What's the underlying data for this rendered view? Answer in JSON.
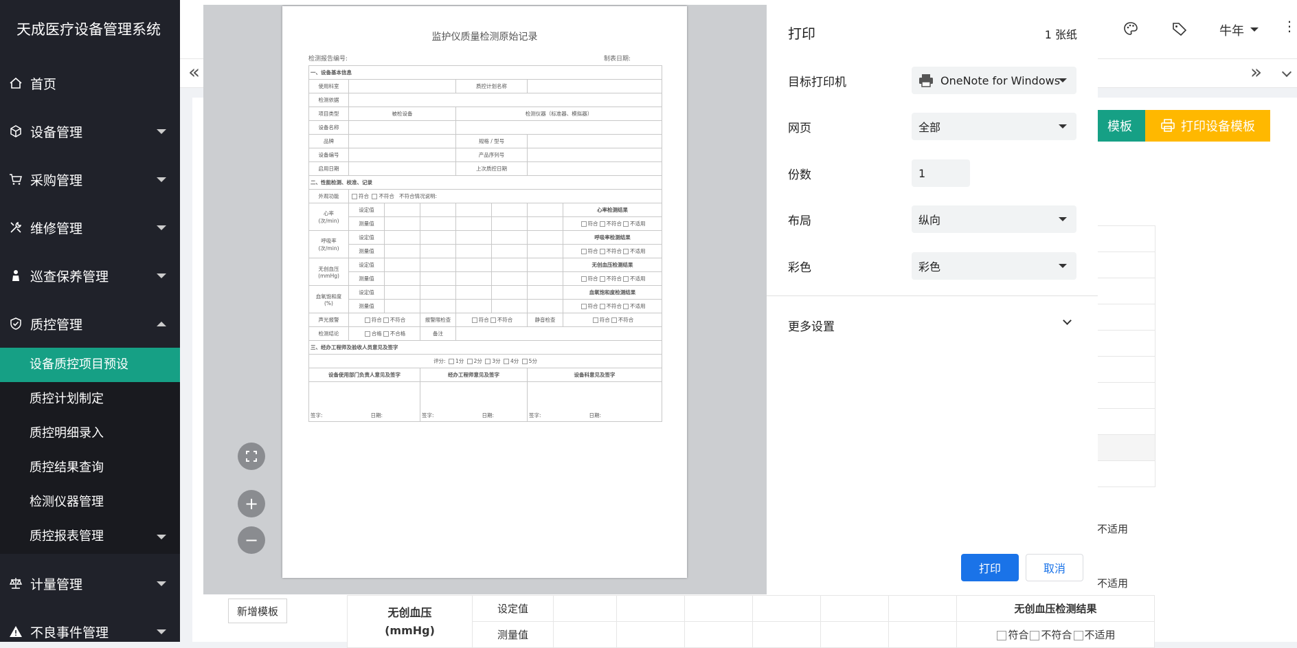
{
  "sidebar": {
    "brand": "天成医疗设备管理系统",
    "items": [
      {
        "label": "首页"
      },
      {
        "label": "设备管理"
      },
      {
        "label": "采购管理"
      },
      {
        "label": "维修管理"
      },
      {
        "label": "巡查保养管理"
      },
      {
        "label": "质控管理"
      }
    ],
    "submenu": [
      {
        "label": "设备质控项目预设"
      },
      {
        "label": "质控计划制定"
      },
      {
        "label": "质控明细录入"
      },
      {
        "label": "质控结果查询"
      },
      {
        "label": "检测仪器管理"
      },
      {
        "label": "质控报表管理"
      }
    ],
    "bottom_items": [
      {
        "label": "计量管理"
      },
      {
        "label": "不良事件管理"
      }
    ]
  },
  "header": {
    "user": "牛年",
    "collapse_glyph": "«",
    "expand_glyph": "»"
  },
  "background": {
    "template_button": "模板",
    "print_template_button": "打印设备模板",
    "add_template_button": "新增模板",
    "not_applicable_1": "不适用",
    "not_applicable_2": "不适用",
    "nibp_label": "无创血压",
    "nibp_unit": "(mmHg)",
    "set_value": "设定值",
    "measured_value": "测量值",
    "nibp_result": "无创血压检测结果",
    "conform": "符合",
    "not_conform": "不符合",
    "not_applicable": "不适用"
  },
  "document": {
    "title": "监护仪质量检测原始记录",
    "report_no": "检测报告编号:",
    "date": "制表日期:",
    "sec1": "一、设备基本信息",
    "use_dept": "使用科室",
    "plan_name": "质控计划名称",
    "basis": "检测依据",
    "item_type": "项目类型",
    "checked_device": "被检设备",
    "instrument": "检测仪器（标准器、模拟器）",
    "device_name": "设备名称",
    "brand": "品牌",
    "model": "规格 / 型号",
    "device_no": "设备编号",
    "serial": "产品序列号",
    "start_date": "启用日期",
    "last_qc": "上次质控日期",
    "sec2": "二、性能检测、校准、记录",
    "appearance": "外观功能",
    "conform": "符合",
    "not_conform": "不符合",
    "not_conform_note": "不符合情况说明:",
    "heart_rate": "心率",
    "per_min": "(次/min)",
    "resp_rate": "呼吸率",
    "nibp": "无创血压",
    "mmhg": "(mmHg)",
    "spo2": "血氧饱和度",
    "percent": "(%)",
    "set_value": "设定值",
    "measured": "测量值",
    "hr_result": "心率检测结果",
    "rr_result": "呼吸率检测结果",
    "nibp_result": "无创血压检测结果",
    "spo2_result": "血氧饱和度检测结果",
    "na": "不适用",
    "sound_alarm": "声光报警",
    "alarm_limit": "报警限检查",
    "silence": "静音检查",
    "conclusion": "检测结论",
    "pass": "合格",
    "fail": "不合格",
    "remark": "备注",
    "sec3": "三、经办工程师及验收人员意见及签字",
    "score": "评分:",
    "s1": "1分",
    "s2": "2分",
    "s3": "3分",
    "s4": "4分",
    "s5": "5分",
    "dept_sign": "设备使用部门负责人意见及签字",
    "eng_sign": "经办工程师意见及签字",
    "equip_sign": "设备科意见及签字",
    "sign": "签字:",
    "sign_date": "日期:"
  },
  "print_dialog": {
    "title": "打印",
    "sheets": "1 张纸",
    "printer_label": "目标打印机",
    "printer_value": "OneNote for Windows",
    "pages_label": "网页",
    "pages_value": "全部",
    "copies_label": "份数",
    "copies_value": "1",
    "layout_label": "布局",
    "layout_value": "纵向",
    "color_label": "彩色",
    "color_value": "彩色",
    "more_settings": "更多设置",
    "print_button": "打印",
    "cancel_button": "取消"
  },
  "colors": {
    "sidebar_bg": "#20222a",
    "active_teal": "#16a085",
    "print_orange": "#ffb800",
    "chrome_blue": "#1a73e8"
  }
}
